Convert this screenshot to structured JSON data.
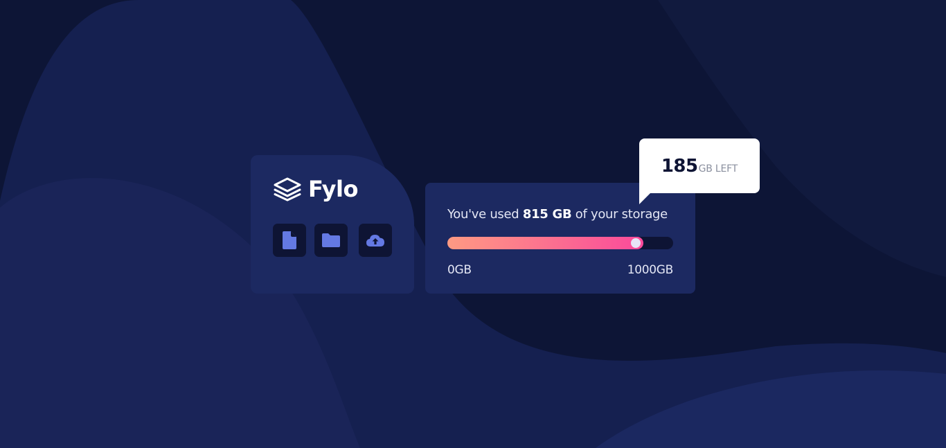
{
  "brand": {
    "name": "Fylo",
    "logo_icon": "layers-icon"
  },
  "file_actions": [
    {
      "icon": "file-icon"
    },
    {
      "icon": "folder-icon"
    },
    {
      "icon": "cloud-upload-icon"
    }
  ],
  "storage": {
    "text_prefix": "You've used ",
    "used_text": "815 GB",
    "text_suffix": " of your storage",
    "used_gb": 815,
    "total_gb": 1000,
    "used_fraction": 0.867,
    "min_label": "0GB",
    "max_label": "1000GB"
  },
  "remaining": {
    "value": "185",
    "unit": "GB LEFT"
  },
  "colors": {
    "background": "#0c1530",
    "card": "#1c2961",
    "icon_bg": "#0e1434",
    "icon_fill": "#6479e3",
    "gradient_start": "#fd9a83",
    "gradient_end": "#fc4a9b"
  }
}
